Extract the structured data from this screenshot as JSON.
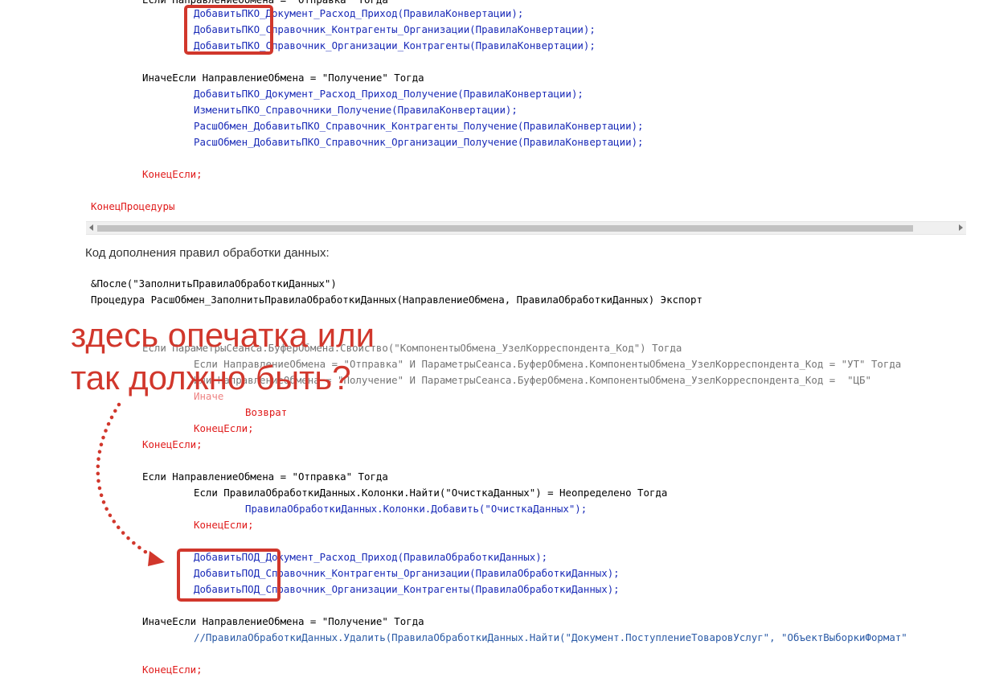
{
  "colors": {
    "keyword": "#e01b1b",
    "function": "#1a2bb8",
    "text": "#000000",
    "annotation": "#d1372c"
  },
  "code_top": [
    {
      "id": 0,
      "text": "Если НаправлениеОбмена = \"Отправка\" Тогда"
    },
    {
      "id": 1,
      "text": "ДобавитьПКО_Документ_Расход_Приход(ПравилаКонвертации);"
    },
    {
      "id": 2,
      "text": "ДобавитьПКО_Справочник_Контрагенты_Организации(ПравилаКонвертации);"
    },
    {
      "id": 3,
      "text": "ДобавитьПКО_Справочник_Организации_Контрагенты(ПравилаКонвертации);"
    },
    {
      "id": 4,
      "text": "ИначеЕсли НаправлениеОбмена = \"Получение\" Тогда"
    },
    {
      "id": 5,
      "text": "ДобавитьПКО_Документ_Расход_Приход_Получение(ПравилаКонвертации);"
    },
    {
      "id": 6,
      "text": "ИзменитьПКО_Справочники_Получение(ПравилаКонвертации);"
    },
    {
      "id": 7,
      "text": "РасшОбмен_ДобавитьПКО_Справочник_Контрагенты_Получение(ПравилаКонвертации);"
    },
    {
      "id": 8,
      "text": "РасшОбмен_ДобавитьПКО_Справочник_Организации_Получение(ПравилаКонвертации);"
    },
    {
      "id": 9,
      "text": "КонецЕсли;"
    },
    {
      "id": 10,
      "text": "КонецПроцедуры"
    }
  ],
  "section_heading": "Код дополнения правил обработки данных:",
  "code_bottom": [
    {
      "id": 0,
      "text": "&После(\"ЗаполнитьПравилаОбработкиДанных\")"
    },
    {
      "id": 1,
      "text": "Процедура РасшОбмен_ЗаполнитьПравилаОбработкиДанных(НаправлениеОбмена, ПравилаОбработкиДанных) Экспорт"
    },
    {
      "id": 2,
      "text": "Если ПараметрыСеанса.БуферОбмена.Свойство(\"КомпонентыОбмена_УзелКорреспондента_Код\") Тогда"
    },
    {
      "id": 3,
      "text": "Если НаправлениеОбмена = \"Отправка\" И ПараметрыСеанса.БуферОбмена.КомпонентыОбмена_УзелКорреспондента_Код = \"УТ\" Тогда"
    },
    {
      "id": 4,
      "text": "Или НаправлениеОбмена = \"Получение\" И ПараметрыСеанса.БуферОбмена.КомпонентыОбмена_УзелКорреспондента_Код =  \"ЦБ\""
    },
    {
      "id": 5,
      "text": "Иначе"
    },
    {
      "id": 6,
      "text": "Возврат"
    },
    {
      "id": 7,
      "text": "КонецЕсли;"
    },
    {
      "id": 8,
      "text": "КонецЕсли;"
    },
    {
      "id": 9,
      "text": "Если НаправлениеОбмена = \"Отправка\" Тогда"
    },
    {
      "id": 10,
      "text": "Если ПравилаОбработкиДанных.Колонки.Найти(\"ОчисткаДанных\") = Неопределено Тогда"
    },
    {
      "id": 11,
      "text": "ПравилаОбработкиДанных.Колонки.Добавить(\"ОчисткаДанных\");"
    },
    {
      "id": 12,
      "text": "КонецЕсли;"
    },
    {
      "id": 13,
      "text": "ДобавитьПОД_Документ_Расход_Приход(ПравилаОбработкиДанных);"
    },
    {
      "id": 14,
      "text": "ДобавитьПОД_Справочник_Контрагенты_Организации(ПравилаОбработкиДанных);"
    },
    {
      "id": 15,
      "text": "ДобавитьПОД_Справочник_Организации_Контрагенты(ПравилаОбработкиДанных);"
    },
    {
      "id": 16,
      "text": "ИначеЕсли НаправлениеОбмена = \"Получение\" Тогда"
    },
    {
      "id": 17,
      "text": "//ПравилаОбработкиДанных.Удалить(ПравилаОбработкиДанных.Найти(\"Документ.ПоступлениеТоваровУслуг\", \"ОбъектВыборкиФормат\""
    },
    {
      "id": 18,
      "text": "КонецЕсли;"
    }
  ],
  "annotation": {
    "line1": "здесь опечатка или",
    "line2": "так должно быть?"
  }
}
